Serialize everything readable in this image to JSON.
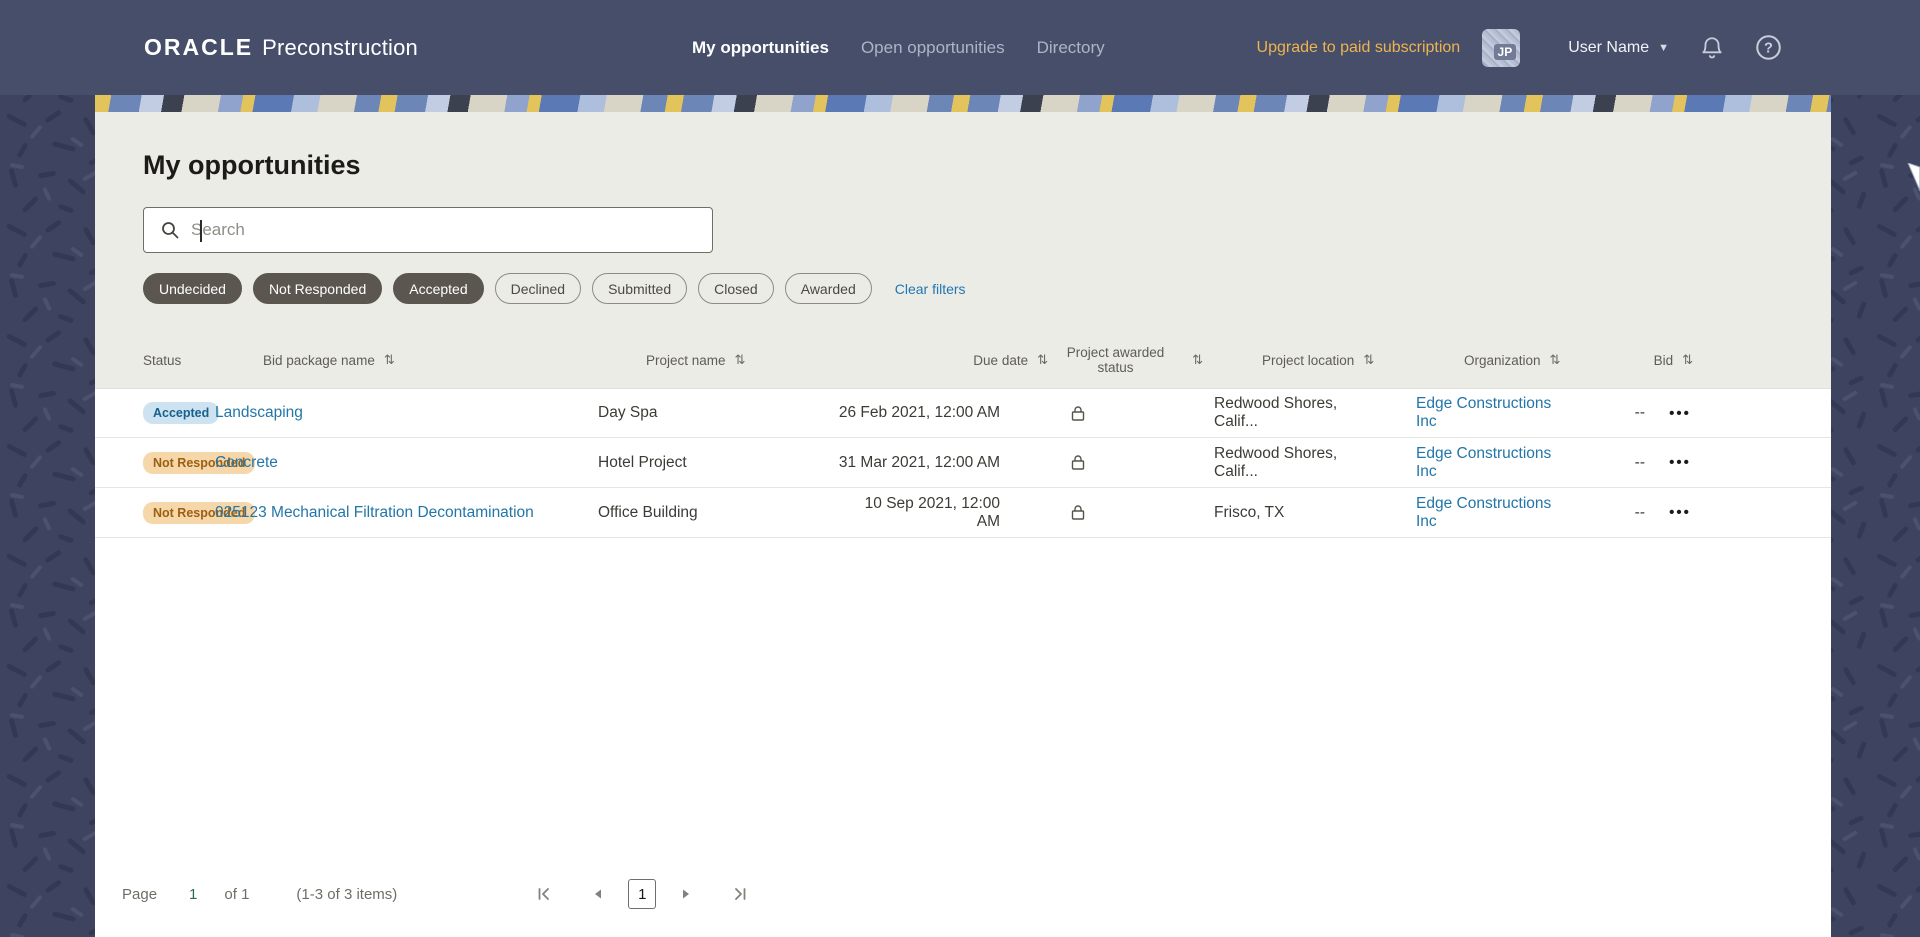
{
  "colors": {
    "header_bg": "#474e6a",
    "body_bg": "#3e4460",
    "content_bg": "#ecece7",
    "accent_gold": "#edb44e",
    "link_blue": "#2276a9",
    "clear_link": "#2276b3",
    "badge_accepted_bg": "#cde3f2",
    "badge_accepted_text": "#19608a",
    "badge_notresponded_bg": "#f6d7a9",
    "badge_notresponded_text": "#9c6014",
    "pill_selected_bg": "#5c5651",
    "pagination_current": "#2c6e49"
  },
  "icons": {
    "sort": "⇅",
    "ellipsis": "•••",
    "caret_down": "▼"
  },
  "header": {
    "logo_brand": "ORACLE",
    "logo_product": "Preconstruction",
    "nav": [
      {
        "label": "My opportunities",
        "active": true
      },
      {
        "label": "Open opportunities",
        "active": false
      },
      {
        "label": "Directory",
        "active": false
      }
    ],
    "upgrade_link": "Upgrade to paid subscription",
    "avatar_initials": "JP",
    "user_menu_label": "User Name"
  },
  "page": {
    "title": "My opportunities",
    "search": {
      "placeholder": "Search",
      "value": ""
    },
    "filters": {
      "pills": [
        {
          "label": "Undecided",
          "selected": true
        },
        {
          "label": "Not Responded",
          "selected": true
        },
        {
          "label": "Accepted",
          "selected": true
        },
        {
          "label": "Declined",
          "selected": false
        },
        {
          "label": "Submitted",
          "selected": false
        },
        {
          "label": "Closed",
          "selected": false
        },
        {
          "label": "Awarded",
          "selected": false
        }
      ],
      "clear_label": "Clear filters"
    }
  },
  "table": {
    "columns": {
      "status": "Status",
      "bid_package": "Bid package name",
      "project_name": "Project name",
      "due_date": "Due date",
      "awarded_status": "Project awarded status",
      "location": "Project location",
      "organization": "Organization",
      "bid": "Bid"
    },
    "rows": [
      {
        "status": "Accepted",
        "bid_package": "Landscaping",
        "project_name": "Day Spa",
        "due_date": "26 Feb 2021, 12:00 AM",
        "awarded_status_icon": "lock",
        "location": "Redwood Shores, Calif...",
        "organization": "Edge Constructions Inc",
        "bid": "--"
      },
      {
        "status": "Not Responded",
        "bid_package": "Concrete",
        "project_name": "Hotel Project",
        "due_date": "31 Mar 2021, 12:00 AM",
        "awarded_status_icon": "lock",
        "location": "Redwood Shores, Calif...",
        "organization": "Edge Constructions Inc",
        "bid": "--"
      },
      {
        "status": "Not Responded",
        "bid_package": "025123 Mechanical Filtration Decontamination",
        "project_name": "Office Building",
        "due_date": "10 Sep 2021, 12:00 AM",
        "awarded_status_icon": "lock",
        "location": "Frisco, TX",
        "organization": "Edge Constructions Inc",
        "bid": "--"
      }
    ]
  },
  "pagination": {
    "page_label": "Page",
    "current_page": "1",
    "of_label": "of 1",
    "items_summary": "(1-3 of 3 items)"
  }
}
